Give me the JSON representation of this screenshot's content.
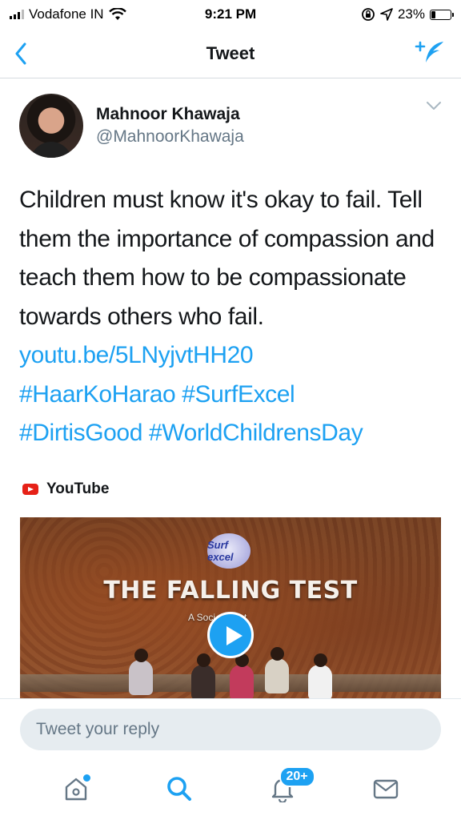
{
  "status_bar": {
    "carrier": "Vodafone IN",
    "time": "9:21 PM",
    "battery": "23%",
    "battery_level": 0.23
  },
  "nav": {
    "title": "Tweet",
    "back_icon": "chevron-left-icon",
    "compose_icon": "compose-tweet-icon"
  },
  "tweet": {
    "author": {
      "display_name": "Mahnoor Khawaja",
      "handle": "@MahnoorKhawaja"
    },
    "text": "Children must know it's okay to fail. Tell them the importance of compassion and teach them how to be compassionate towards others who fail.",
    "link": "youtu.be/5LNyjvtHH20",
    "hashtags": [
      "#HaarKoHarao",
      "#SurfExcel",
      "#DirtisGood",
      "#WorldChildrensDay"
    ],
    "card": {
      "source": "YouTube",
      "brand": "Surf excel",
      "video_title": "THE FALLING TEST",
      "video_subtitle": "A Soci...iment"
    }
  },
  "reply": {
    "placeholder": "Tweet your reply"
  },
  "tab_bar": {
    "items": [
      {
        "icon": "home-icon"
      },
      {
        "icon": "search-icon"
      },
      {
        "icon": "notifications-icon",
        "badge": "20+"
      },
      {
        "icon": "messages-icon"
      }
    ]
  },
  "colors": {
    "accent": "#1da1f2",
    "text": "#14171a",
    "secondary": "#657786",
    "youtube": "#e62117"
  }
}
